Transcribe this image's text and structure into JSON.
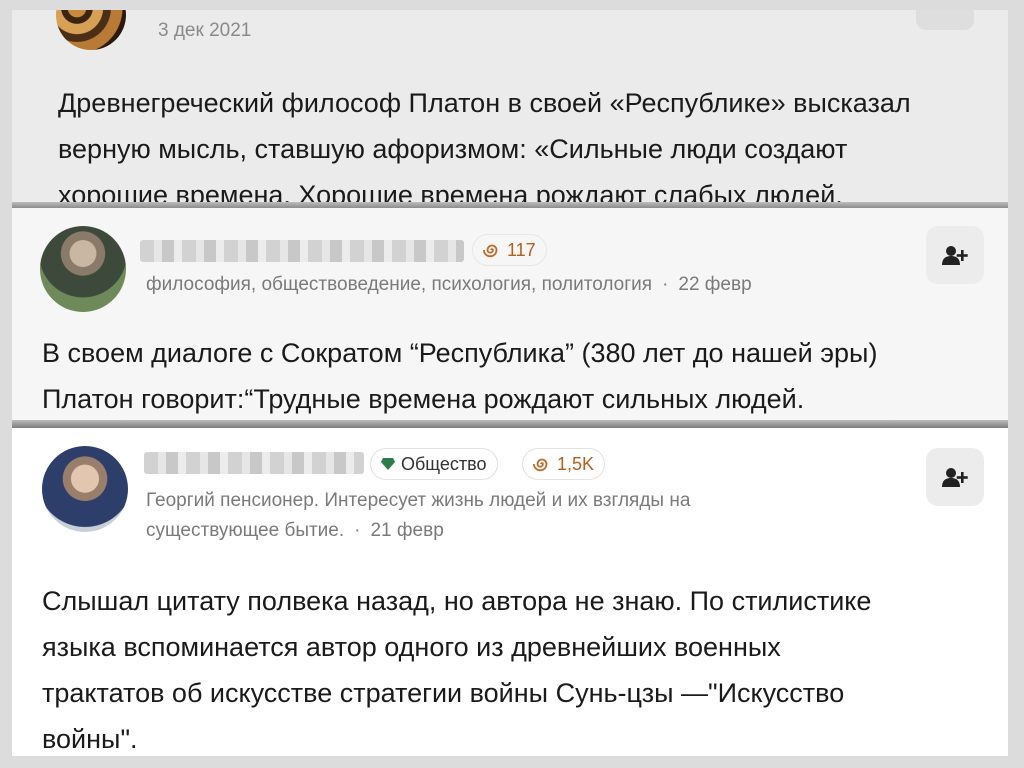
{
  "card1": {
    "date": "3 дек 2021",
    "lines": [
      "Древнегреческий философ Платон в своей «Республике» высказал",
      "верную мысль, ставшую афоризмом: «Сильные люди создают",
      "хорошие времена. Хорошие времена рождают слабых людей."
    ]
  },
  "card2": {
    "score": "117",
    "meta": "философия, обществоведение, психология, политология",
    "date": "22 февр",
    "separator": "·",
    "lines": [
      "В своем диалоге с Сократом “Республика” (380 лет до нашей эры)",
      "Платон говорит:“Трудные времена рождают сильных людей."
    ]
  },
  "card3": {
    "topic": "Общество",
    "score": "1,5K",
    "meta_line1": "Георгий пенсионер. Интересует жизнь людей и их взгляды на",
    "meta_line2": "существующее бытие.",
    "date": "21 февр",
    "separator": "·",
    "lines": [
      "Слышал цитату полвека назад, но автора не знаю. По стилистике",
      "языка вспоминается автор одного из древнейших военных",
      "трактатов об искусстве стратегии войны Сунь-цзы —\"Искусство",
      "войны\"."
    ]
  },
  "icons": {
    "score": "spiral-icon",
    "topic": "gem-icon",
    "follow": "person-add-icon"
  },
  "colors": {
    "score_accent": "#b85e1c",
    "meta_text": "#7a7a7a"
  }
}
